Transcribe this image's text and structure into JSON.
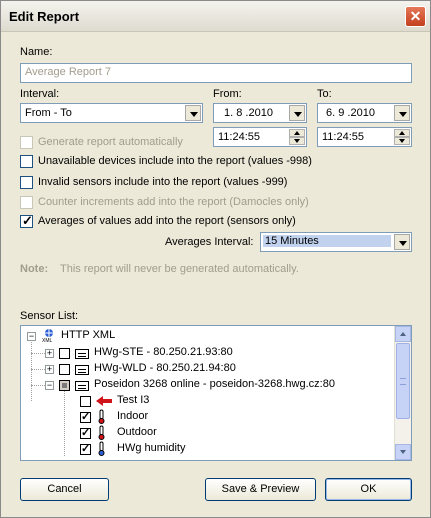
{
  "window": {
    "title": "Edit Report",
    "close_glyph": "✕"
  },
  "name": {
    "label": "Name:",
    "value": "Average Report 7"
  },
  "interval": {
    "label": "Interval:",
    "value": "From - To"
  },
  "from": {
    "label": "From:",
    "date": "1. 8 .2010",
    "time": "11:24:55"
  },
  "to": {
    "label": "To:",
    "date": "6. 9 .2010",
    "time": "11:24:55"
  },
  "options": [
    {
      "label": "Generate report automatically",
      "checked": false,
      "enabled": false
    },
    {
      "label": "Unavailable devices include into the report (values -998)",
      "checked": false,
      "enabled": true
    },
    {
      "label": "Invalid sensors include into the report (values -999)",
      "checked": false,
      "enabled": true
    },
    {
      "label": "Counter increments add into the report (Damocles only)",
      "checked": false,
      "enabled": false
    },
    {
      "label": "Averages of values add into the report (sensors only)",
      "checked": true,
      "enabled": true
    }
  ],
  "averages_interval": {
    "label": "Averages Interval:",
    "value": "15 Minutes"
  },
  "note": {
    "label": "Note:",
    "text": "This report will never be generated automatically."
  },
  "sensor_list": {
    "label": "Sensor List:",
    "root": "HTTP XML",
    "items": [
      "HWg-STE - 80.250.21.93:80",
      "HWg-WLD - 80.250.21.94:80",
      "Poseidon 3268 online - poseidon-3268.hwg.cz:80",
      "Test I3",
      "Indoor",
      "Outdoor",
      "HWg humidity"
    ]
  },
  "buttons": {
    "cancel": "Cancel",
    "save_preview": "Save & Preview",
    "ok": "OK"
  },
  "colors": {
    "title_close": "#C3401E",
    "selection": "#C1D2EE",
    "field_border": "#7F9DB9"
  }
}
